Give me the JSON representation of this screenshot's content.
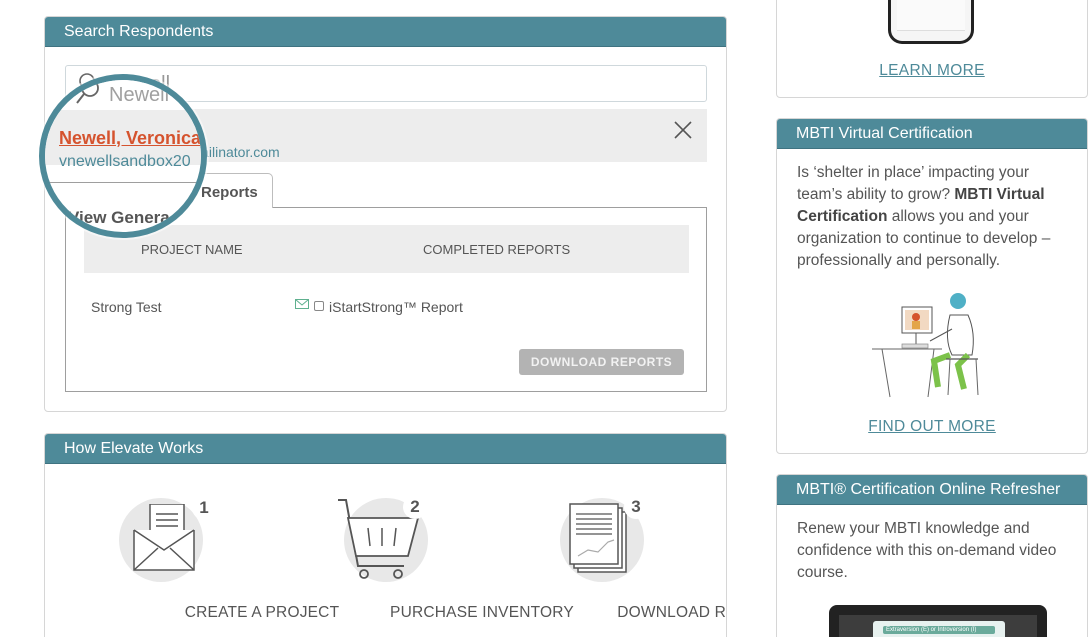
{
  "search_panel": {
    "title": "Search Respondents",
    "search_value": "Newell",
    "result": {
      "name": "Newell, Veronica",
      "email_visible": "vnewellsandbox20",
      "email_suffix": "@mailinator.com"
    },
    "tab_label": "Reports",
    "tab_label_partial": "View Genera",
    "table": {
      "headers": [
        "PROJECT NAME",
        "COMPLETED REPORTS"
      ],
      "rows": [
        {
          "project": "Strong Test",
          "report": "iStartStrong™ Report"
        }
      ]
    },
    "download_button": "DOWNLOAD REPORTS"
  },
  "how_panel": {
    "title": "How Elevate Works",
    "steps": [
      {
        "number": "1",
        "label": "CREATE A PROJECT",
        "icon": "envelope-icon"
      },
      {
        "number": "2",
        "label": "PURCHASE INVENTORY",
        "icon": "cart-icon"
      },
      {
        "number": "3",
        "label": "DOWNLOAD REPORTS",
        "icon": "report-stack-icon"
      }
    ]
  },
  "right_column": {
    "learn_more": "LEARN MORE",
    "mbti_card": {
      "title": "MBTI Virtual Certification",
      "text_1": "Is ‘shelter in place’ impacting your team’s ability to grow? ",
      "text_bold": "MBTI Virtual Certification",
      "text_2": " allows you and your organization to continue to develop – professionally and personally.",
      "link": "FIND OUT MORE"
    },
    "refresher_card": {
      "title": "MBTI® Certification Online Refresher",
      "text": "Renew your MBTI knowledge and confidence with this on-demand video course.",
      "slide_title": "Extraversion (E) or Introversion (I)"
    }
  },
  "colors": {
    "header": "#4e8a99",
    "link": "#4e8a99",
    "name_accent": "#d5532e",
    "button_disabled": "#b3b3b3"
  }
}
